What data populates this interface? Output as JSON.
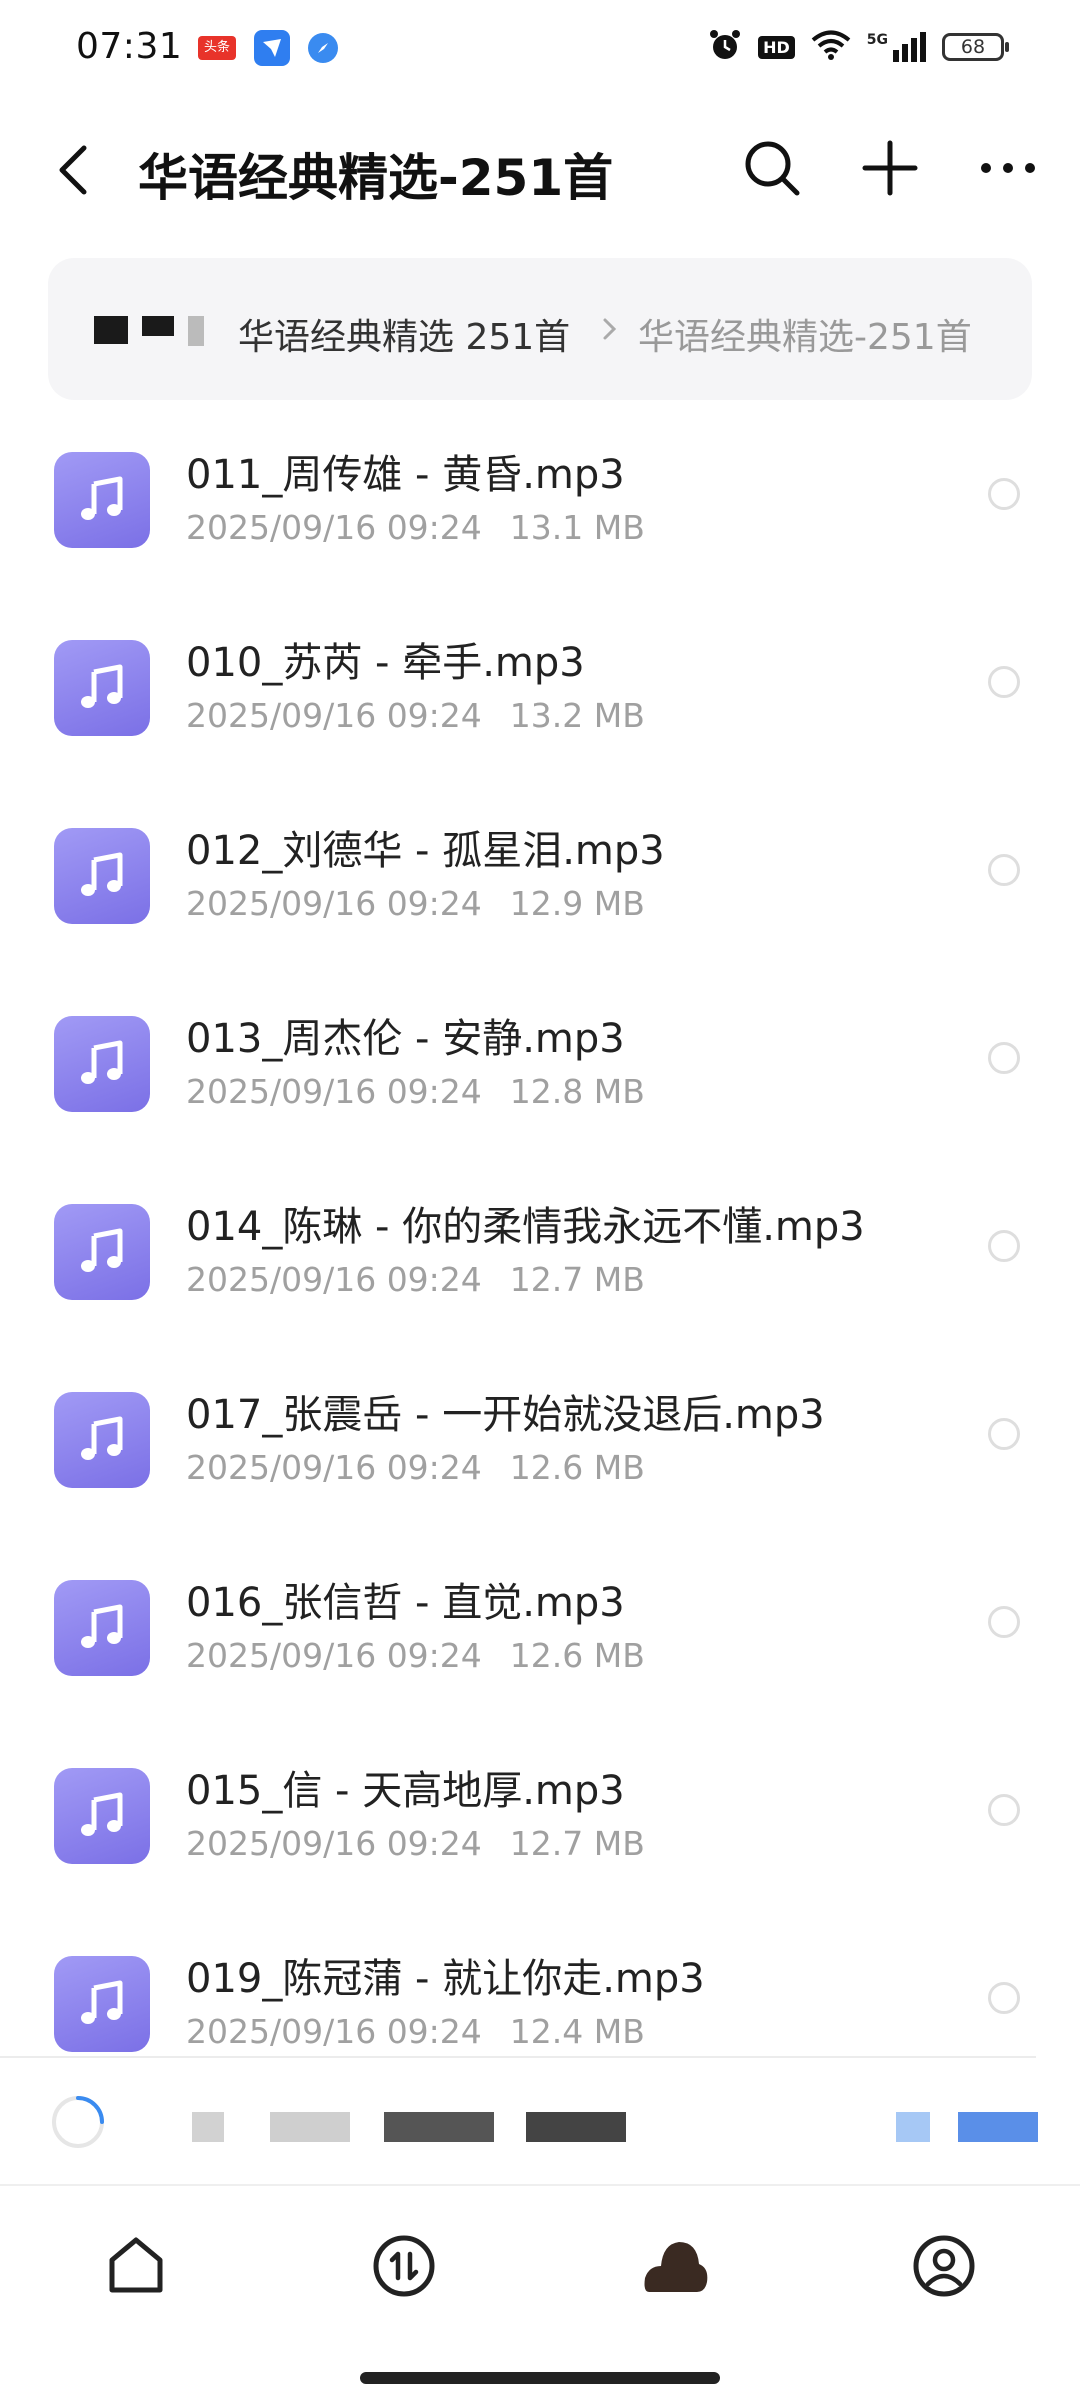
{
  "status_bar": {
    "time": "07:31",
    "toutiao_label": "头条",
    "hd_label": "HD",
    "signal_label": "5G",
    "battery": "68"
  },
  "header": {
    "title": "华语经典精选-251首"
  },
  "breadcrumb": {
    "parent": "华语经典精选 251首",
    "current": "华语经典精选-251首"
  },
  "colors": {
    "icon_gradient_start": "#a19af5",
    "icon_gradient_end": "#7b70e6",
    "meta_text": "#a0a0a0",
    "accent_spinner": "#3a8bf0"
  },
  "files": [
    {
      "name": "011_周传雄 - 黄昏.mp3",
      "date": "2025/09/16 09:24",
      "size": "13.1 MB"
    },
    {
      "name": "010_苏芮 - 牵手.mp3",
      "date": "2025/09/16 09:24",
      "size": "13.2 MB"
    },
    {
      "name": "012_刘德华 - 孤星泪.mp3",
      "date": "2025/09/16 09:24",
      "size": "12.9 MB"
    },
    {
      "name": "013_周杰伦 - 安静.mp3",
      "date": "2025/09/16 09:24",
      "size": "12.8 MB"
    },
    {
      "name": "014_陈琳 - 你的柔情我永远不懂.mp3",
      "date": "2025/09/16 09:24",
      "size": "12.7 MB"
    },
    {
      "name": "017_张震岳 - 一开始就没退后.mp3",
      "date": "2025/09/16 09:24",
      "size": "12.6 MB"
    },
    {
      "name": "016_张信哲 - 直觉.mp3",
      "date": "2025/09/16 09:24",
      "size": "12.6 MB"
    },
    {
      "name": "015_信 - 天高地厚.mp3",
      "date": "2025/09/16 09:24",
      "size": "12.7 MB"
    },
    {
      "name": "019_陈冠蒲 - 就让你走.mp3",
      "date": "2025/09/16 09:24",
      "size": "12.4 MB"
    }
  ],
  "icons": {
    "back": "chevron-left-icon",
    "search": "search-icon",
    "add": "plus-icon",
    "more": "more-horizontal-icon",
    "file": "music-note-icon",
    "nav": [
      "home-icon",
      "transfer-icon",
      "cloud-icon",
      "profile-icon"
    ]
  }
}
